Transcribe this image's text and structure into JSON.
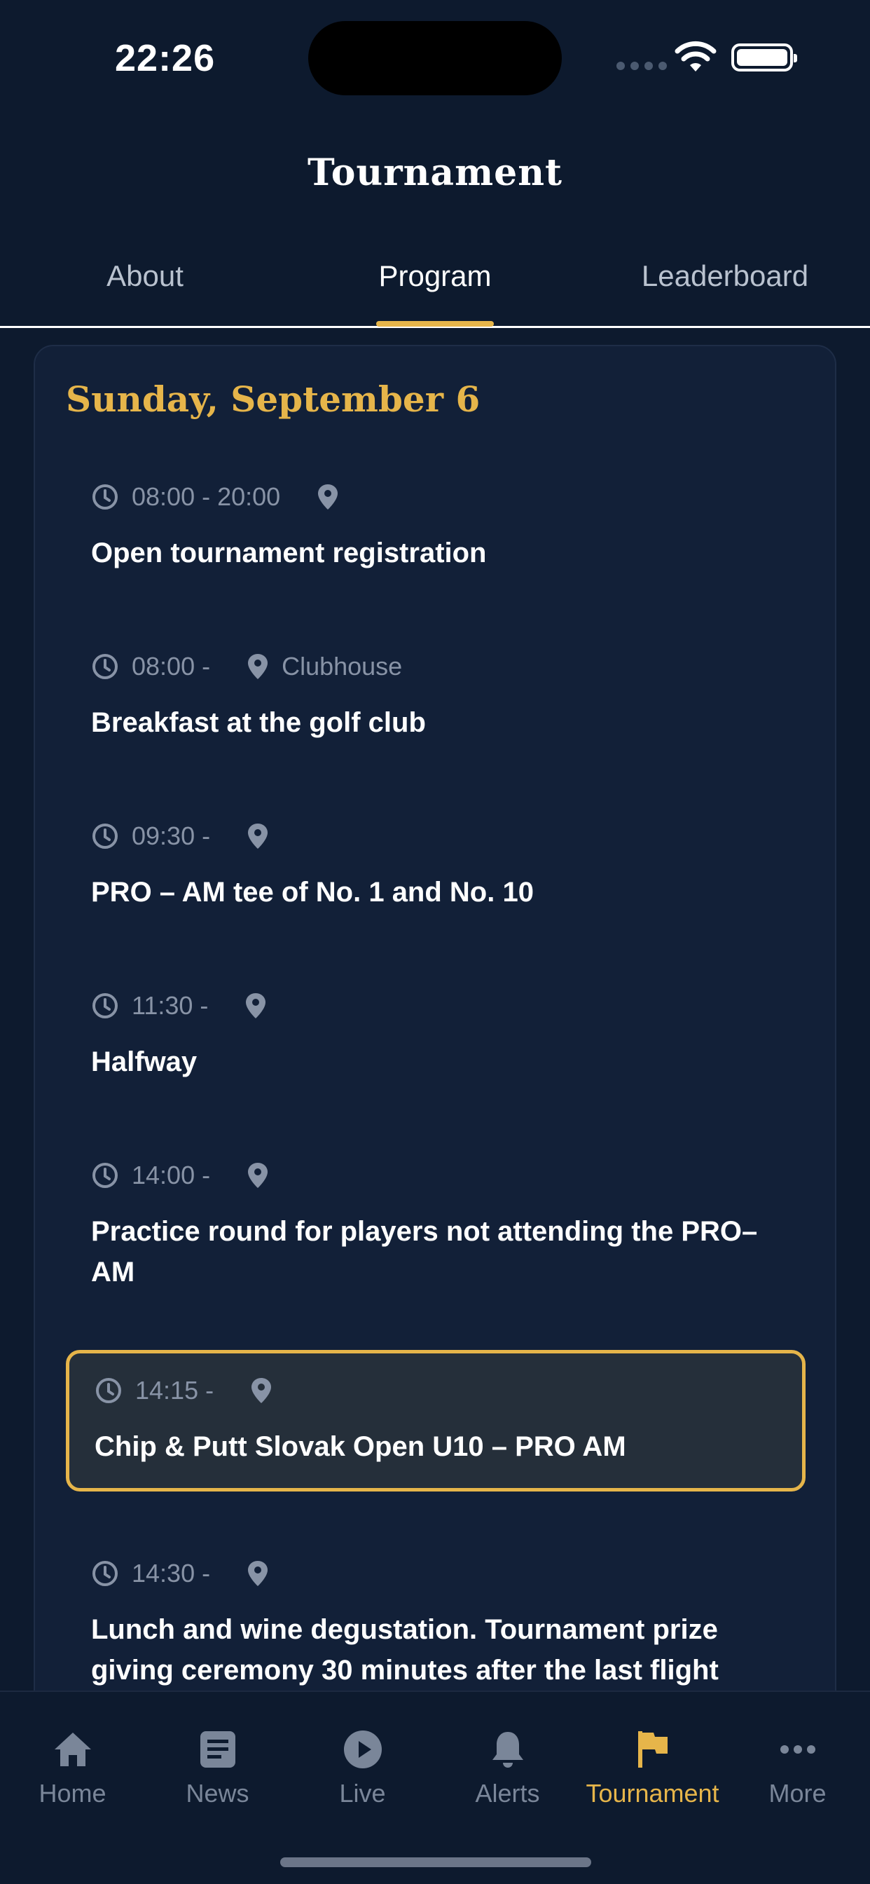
{
  "status_bar": {
    "time": "22:26"
  },
  "header": {
    "title": "Tournament"
  },
  "tabs": [
    {
      "label": "About"
    },
    {
      "label": "Program"
    },
    {
      "label": "Leaderboard"
    }
  ],
  "active_tab": "Program",
  "program": {
    "day_title": "Sunday, September 6",
    "events": [
      {
        "time": "08:00 - 20:00",
        "location": "",
        "title": "Open tournament registration"
      },
      {
        "time": "08:00 -",
        "location": "Clubhouse",
        "title": "Breakfast at the golf club"
      },
      {
        "time": "09:30 -",
        "location": "",
        "title": "PRO – AM tee of No. 1 and No. 10"
      },
      {
        "time": "11:30 -",
        "location": "",
        "title": "Halfway"
      },
      {
        "time": "14:00 -",
        "location": "",
        "title": "Practice round for players not attending the PRO–AM"
      },
      {
        "time": "14:15 -",
        "location": "",
        "title": "Chip & Putt Slovak Open U10 – PRO AM"
      },
      {
        "time": "14:30 -",
        "location": "",
        "title": "Lunch and wine degustation. Tournament prize giving ceremony 30 minutes after the last flight"
      }
    ]
  },
  "tabbar": {
    "items": [
      {
        "label": "Home",
        "icon": "home-icon"
      },
      {
        "label": "News",
        "icon": "news-icon"
      },
      {
        "label": "Live",
        "icon": "play-icon"
      },
      {
        "label": "Alerts",
        "icon": "bell-icon"
      },
      {
        "label": "Tournament",
        "icon": "flag-icon"
      },
      {
        "label": "More",
        "icon": "more-icon"
      }
    ],
    "active": "Tournament"
  },
  "colors": {
    "background": "#0d1a2e",
    "card": "#122038",
    "accent": "#e6b54a",
    "muted": "#8893a6"
  }
}
